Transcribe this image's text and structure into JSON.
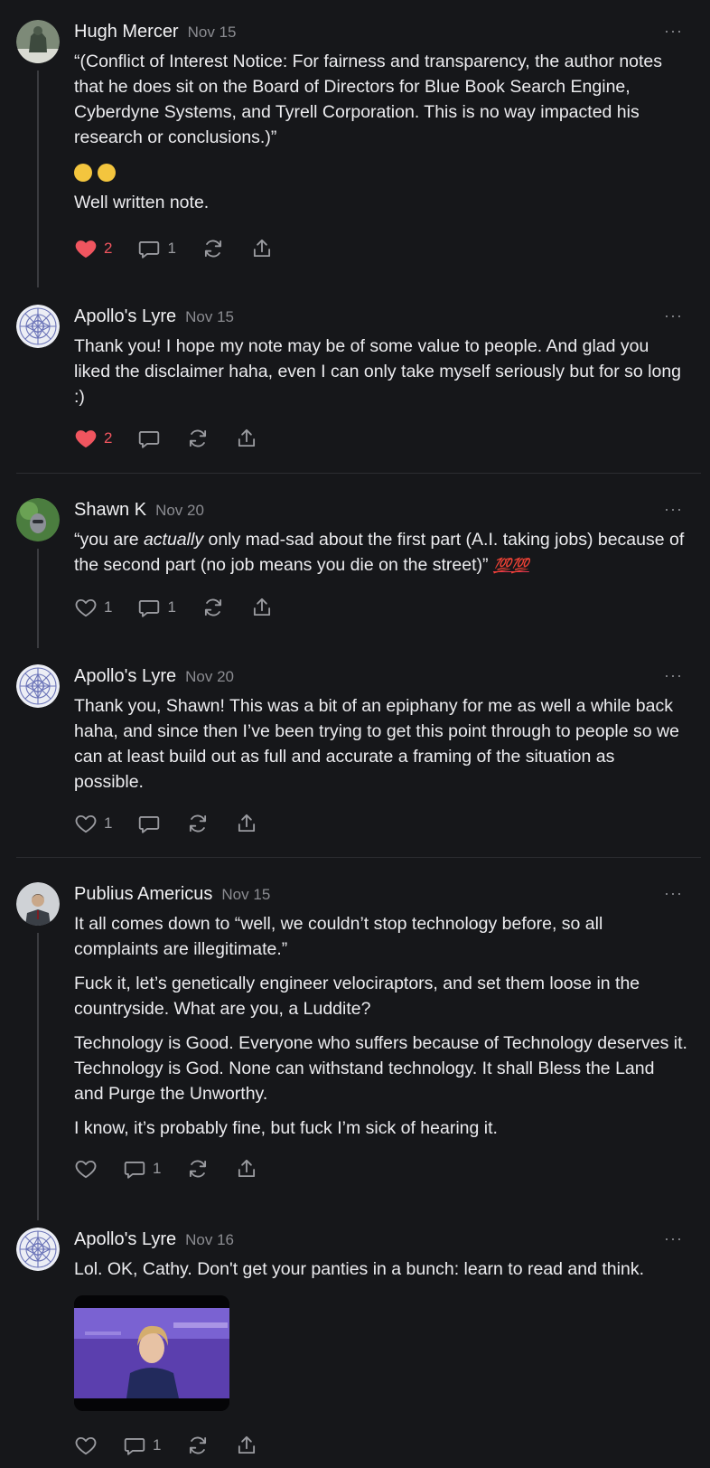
{
  "comments": [
    {
      "name": "Hugh Mercer",
      "date": "Nov 15",
      "paragraphs": [
        "“(Conflict of Interest Notice: For fairness and transparency, the author notes that he does sit on the Board of Directors for Blue Book Search Engine, Cyberdyne Systems, and Tyrell Corporation. This is no way impacted his research or conclusions.)”",
        "Well written note."
      ],
      "likes": "2",
      "replies": "1",
      "liked": true
    },
    {
      "name": "Apollo's Lyre",
      "date": "Nov 15",
      "paragraphs": [
        "Thank you! I hope my note may be of some value to people. And glad you liked the disclaimer haha, even I can only take myself seriously but for so long :)"
      ],
      "likes": "2",
      "replies": "",
      "liked": true
    },
    {
      "name": "Shawn K",
      "date": "Nov 20",
      "para_pre": "“you are ",
      "para_em": "actually",
      "para_post": " only mad-sad about the first part (A.I. taking jobs) because of the second part (no job means you die on the street)” ",
      "para_emoji": "💯💯",
      "likes": "1",
      "replies": "1"
    },
    {
      "name": "Apollo's Lyre",
      "date": "Nov 20",
      "paragraphs": [
        "Thank you, Shawn! This was a bit of an epiphany for me as well a while back haha, and since then I’ve been trying to get this point through to people so we can at least build out as full and accurate a framing of the situation as possible."
      ],
      "likes": "1",
      "replies": ""
    },
    {
      "name": "Publius Americus",
      "date": "Nov 15",
      "paragraphs": [
        "It all comes down to “well, we couldn’t stop technology before, so all complaints are illegitimate.”",
        "Fuck it, let’s genetically engineer velociraptors, and set them loose in the countryside. What are you, a Luddite?",
        "Technology is Good. Everyone who suffers because of Technology deserves it. Technology is God. None can withstand technology. It shall Bless the Land and Purge the Unworthy.",
        "I know, it’s probably fine, but fuck I’m sick of hearing it."
      ],
      "likes": "",
      "replies": "1"
    },
    {
      "name": "Apollo's Lyre",
      "date": "Nov 16",
      "paragraphs": [
        "Lol. OK, Cathy. Don't get your panties in a bunch: learn to read and think."
      ],
      "likes": "",
      "replies": "1"
    }
  ],
  "ui": {
    "more": "···"
  },
  "colors": {
    "background": "#16171a",
    "liked": "#f0555f",
    "muted": "#9a9ba0"
  }
}
